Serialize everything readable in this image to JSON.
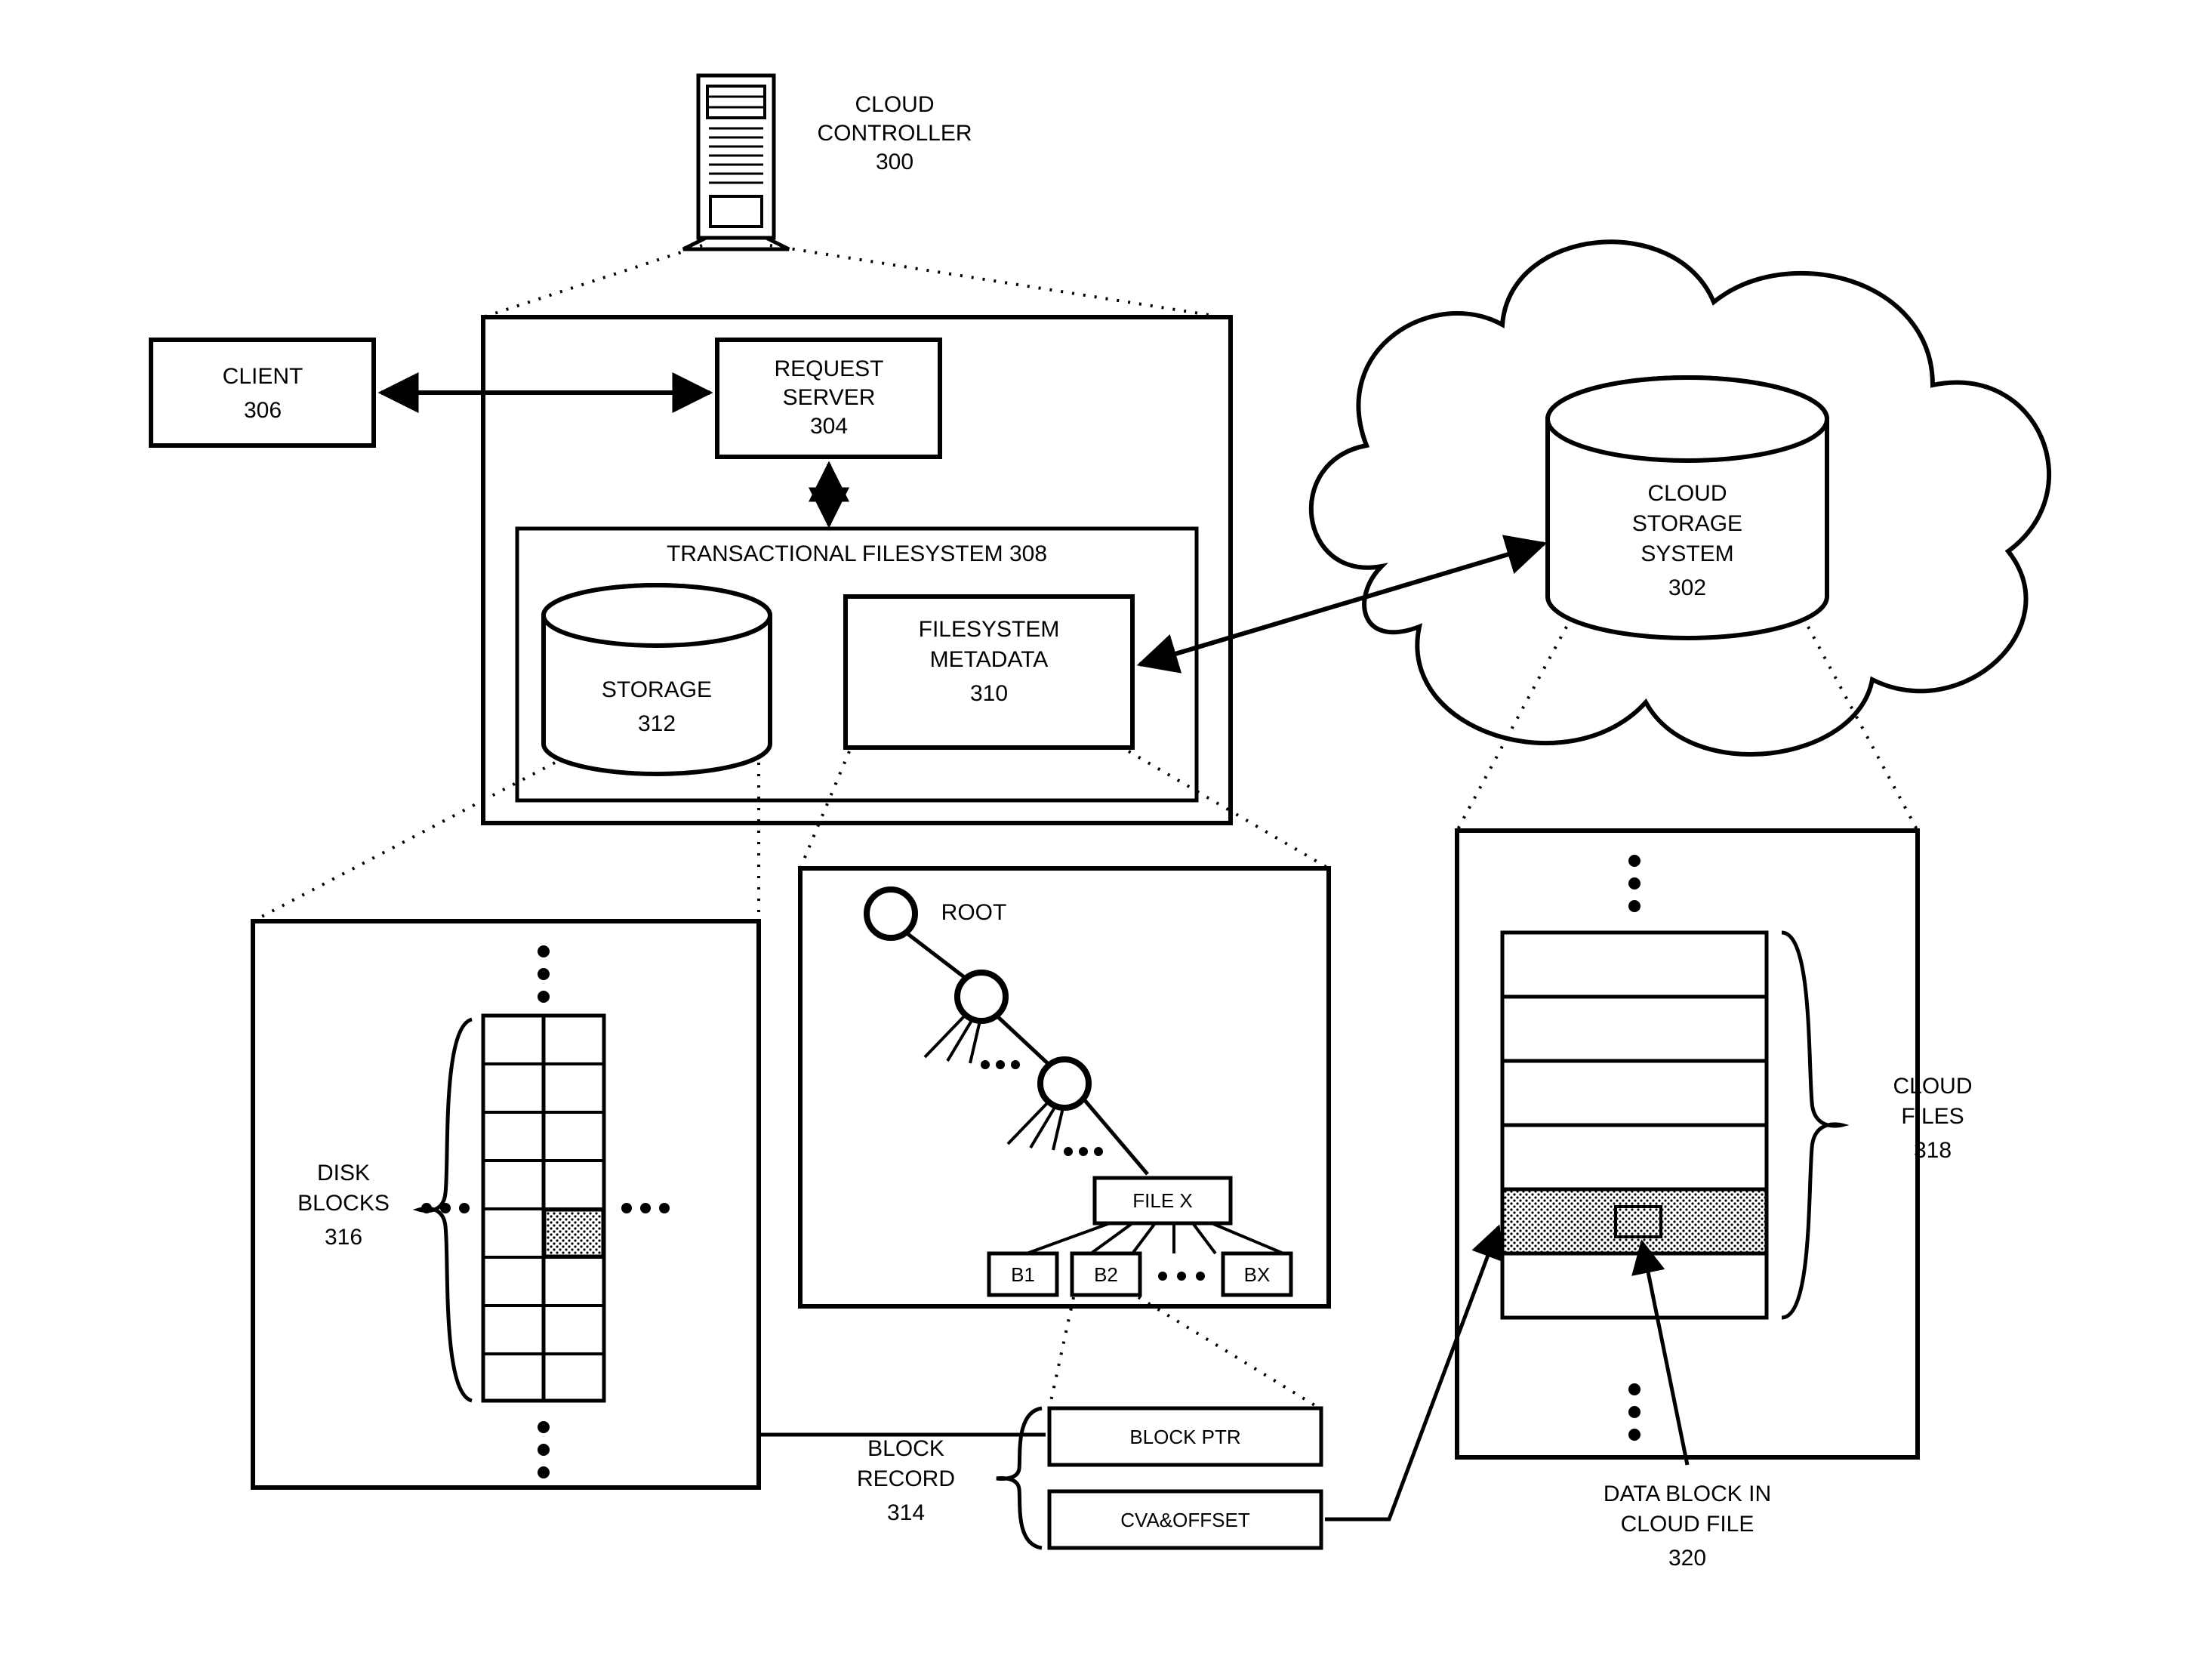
{
  "nodes": {
    "cloud_controller": {
      "l1": "CLOUD",
      "l2": "CONTROLLER",
      "num": "300"
    },
    "client": {
      "l1": "CLIENT",
      "num": "306"
    },
    "request_server": {
      "l1": "REQUEST",
      "l2": "SERVER",
      "num": "304"
    },
    "tx_fs": {
      "title": "TRANSACTIONAL FILESYSTEM 308"
    },
    "storage": {
      "l1": "STORAGE",
      "num": "312"
    },
    "fs_meta": {
      "l1": "FILESYSTEM",
      "l2": "METADATA",
      "num": "310"
    },
    "cloud_storage": {
      "l1": "CLOUD",
      "l2": "STORAGE",
      "l3": "SYSTEM",
      "num": "302"
    },
    "disk_blocks": {
      "l1": "DISK",
      "l2": "BLOCKS",
      "num": "316"
    },
    "root": "ROOT",
    "file_x": "FILE X",
    "b1": "B1",
    "b2": "B2",
    "bx": "BX",
    "block_record": {
      "l1": "BLOCK",
      "l2": "RECORD",
      "num": "314"
    },
    "block_ptr": "BLOCK PTR",
    "cva_offset": "CVA&OFFSET",
    "cloud_files": {
      "l1": "CLOUD",
      "l2": "FILES",
      "num": "318"
    },
    "data_block": {
      "l1": "DATA BLOCK IN",
      "l2": "CLOUD FILE",
      "num": "320"
    }
  }
}
